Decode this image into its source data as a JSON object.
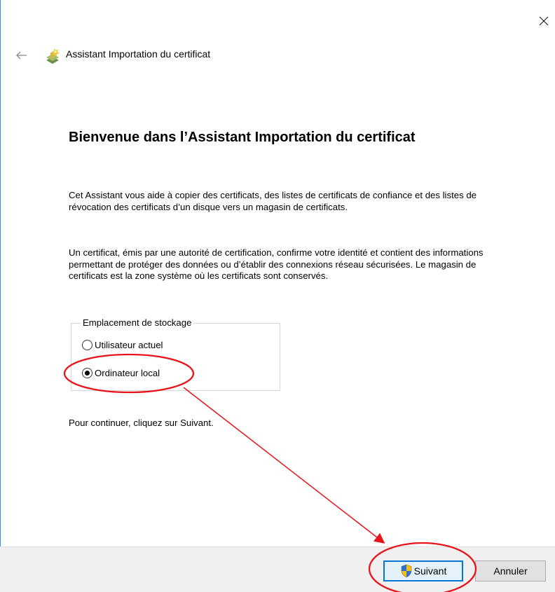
{
  "window": {
    "title": "Assistant Importation du certificat",
    "close_glyph": "×",
    "back_glyph": "←"
  },
  "content": {
    "heading": "Bienvenue dans l’Assistant Importation du certificat",
    "paragraph1": "Cet Assistant vous aide à copier des certificats, des listes de certificats de confiance et des listes de révocation des certificats d’un disque vers un magasin de certificats.",
    "paragraph2": "Un certificat, émis par une autorité de certification, confirme votre identité et contient des informations permettant de protéger des données ou d’établir des connexions réseau sécurisées. Le magasin de certificats est la zone système où les certificats sont conservés.",
    "storage_group": {
      "legend": "Emplacement de stockage",
      "options": [
        {
          "label": "Utilisateur actuel",
          "selected": false
        },
        {
          "label": "Ordinateur local",
          "selected": true
        }
      ]
    },
    "continue_text": "Pour continuer, cliquez sur Suivant."
  },
  "footer": {
    "next_label": "Suivant",
    "cancel_label": "Annuler"
  },
  "icons": {
    "back": "arrow-left-icon",
    "close": "close-icon",
    "app": "certificate-wizard-icon",
    "next_button": "uac-shield-icon"
  },
  "colors": {
    "accent": "#0078d7",
    "annotation": "#e8141b",
    "footer_bg": "#f0f0f0",
    "window_border": "#3c8fe0"
  }
}
